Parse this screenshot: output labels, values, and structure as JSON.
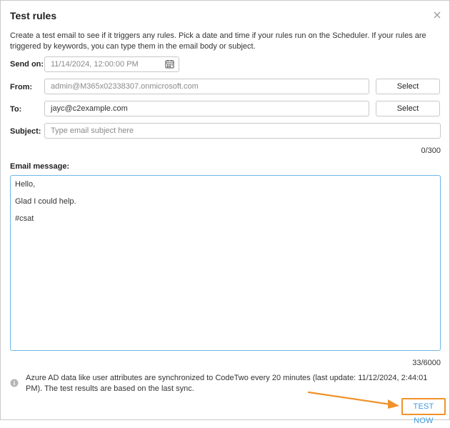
{
  "dialog": {
    "title": "Test rules",
    "intro": "Create a test email to see if it triggers any rules. Pick a date and time if your rules run on the Scheduler. If your rules are triggered by keywords, you can type them in the email body or subject."
  },
  "form": {
    "send_on": {
      "label": "Send on:",
      "value": "11/14/2024, 12:00:00 PM"
    },
    "from": {
      "label": "From:",
      "value": "admin@M365x02338307.onmicrosoft.com",
      "button": "Select"
    },
    "to": {
      "label": "To:",
      "value": "jayc@c2example.com",
      "button": "Select"
    },
    "subject": {
      "label": "Subject:",
      "placeholder": "Type email subject here",
      "counter": "0/300"
    },
    "message": {
      "label": "Email message:",
      "lines": [
        "Hello,",
        "Glad I could help.",
        "#csat"
      ],
      "counter": "33/6000"
    }
  },
  "info": {
    "text": "Azure AD data like user attributes are synchronized to CodeTwo every 20 minutes (last update: 11/12/2024, 2:44:01 PM). The test results are based on the last sync."
  },
  "actions": {
    "test_now": "TEST NOW"
  },
  "icons": {
    "close": "close-icon",
    "calendar": "calendar-icon",
    "info": "info-icon",
    "annotation": "annotation-arrow-icon"
  },
  "colors": {
    "accent": "#3d9be0",
    "highlight": "#f0922b",
    "focus_border": "#6fb6e6"
  }
}
